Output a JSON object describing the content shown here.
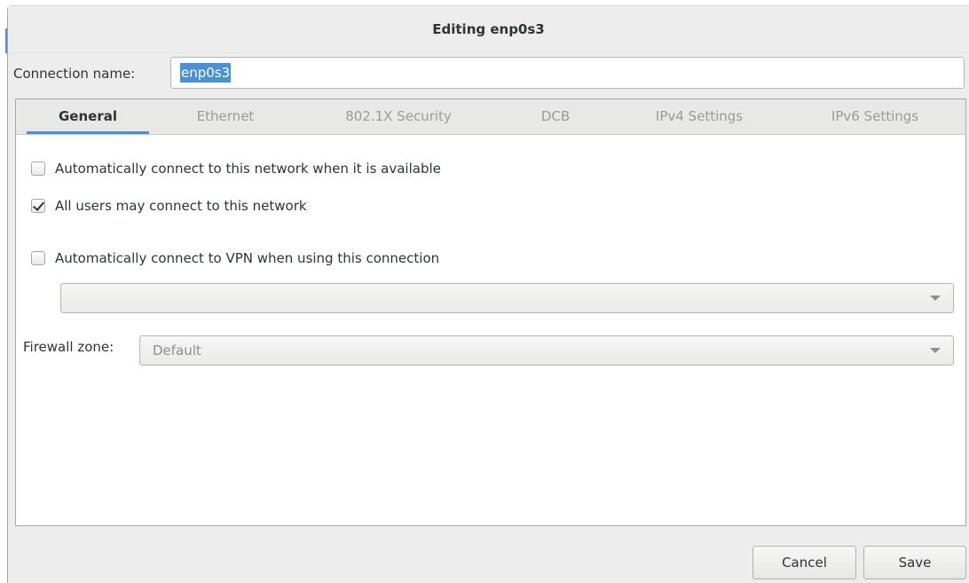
{
  "dialog": {
    "title": "Editing enp0s3"
  },
  "connection": {
    "label": "Connection name:",
    "value": "enp0s3"
  },
  "tabs": [
    {
      "label": "General",
      "active": true
    },
    {
      "label": "Ethernet",
      "active": false
    },
    {
      "label": "802.1X Security",
      "active": false
    },
    {
      "label": "DCB",
      "active": false
    },
    {
      "label": "IPv4 Settings",
      "active": false
    },
    {
      "label": "IPv6 Settings",
      "active": false
    }
  ],
  "general": {
    "auto_connect": {
      "label": "Automatically connect to this network when it is available",
      "checked": false
    },
    "all_users": {
      "label": "All users may connect to this network",
      "checked": true
    },
    "auto_vpn": {
      "label": "Automatically connect to VPN when using this connection",
      "checked": false
    },
    "vpn_select": {
      "value": ""
    },
    "firewall_zone": {
      "label": "Firewall zone:",
      "value": "Default"
    }
  },
  "buttons": {
    "cancel": "Cancel",
    "save": "Save"
  },
  "colors": {
    "accent": "#4a90d9",
    "background": "#ededed",
    "panel": "#ffffff"
  }
}
